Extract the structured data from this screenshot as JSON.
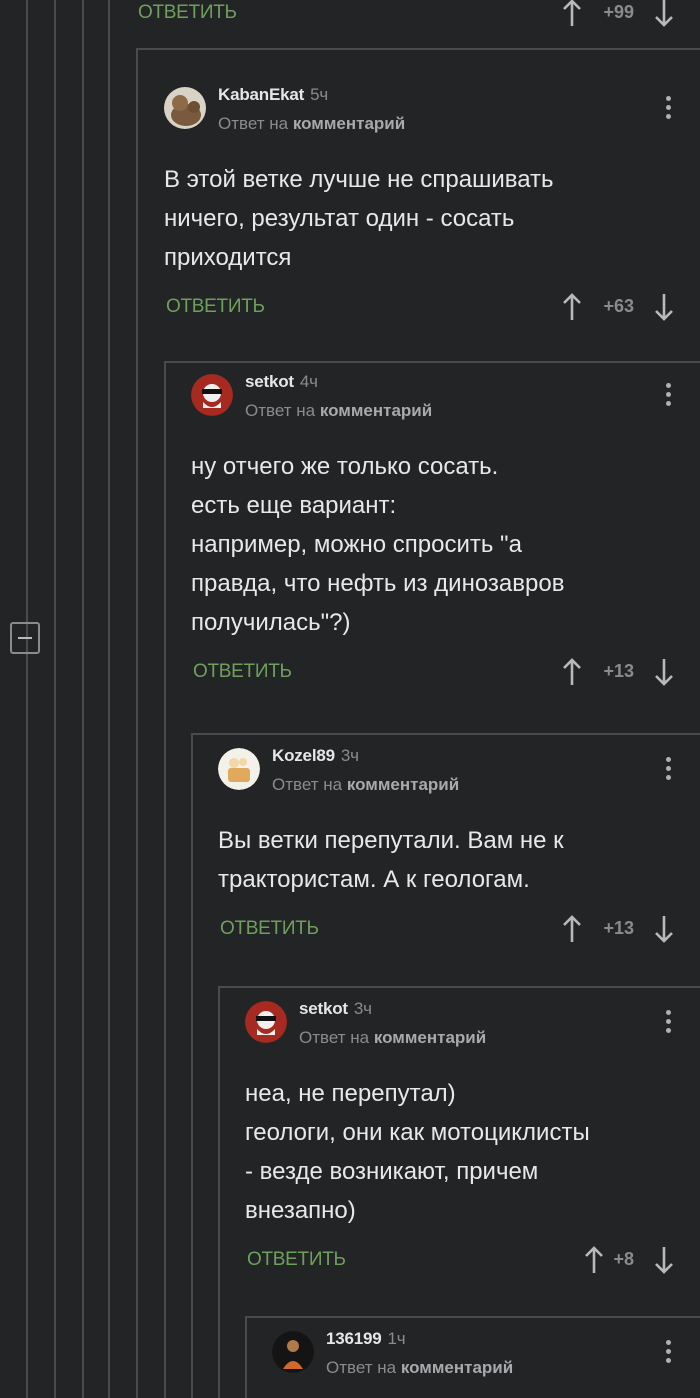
{
  "top_actions": {
    "answer": "ОТВЕТИТЬ",
    "rating": "+99"
  },
  "comments": [
    {
      "username": "KabanEkat",
      "time": "5ч",
      "reply_prefix": "Ответ на",
      "reply_link": "комментарий",
      "lines": [
        "В этой ветке лучше не спрашивать",
        "ничего, результат один - сосать",
        "приходится"
      ],
      "answer": "ОТВЕТИТЬ",
      "rating": "+63"
    },
    {
      "username": "setkot",
      "time": "4ч",
      "reply_prefix": "Ответ на",
      "reply_link": "комментарий",
      "lines": [
        "ну отчего же только сосать.",
        "есть еще вариант:",
        "например, можно спросить \"а",
        "правда, что нефть из динозавров",
        "получилась\"?)"
      ],
      "answer": "ОТВЕТИТЬ",
      "rating": "+13"
    },
    {
      "username": "Kozel89",
      "time": "3ч",
      "reply_prefix": "Ответ на",
      "reply_link": "комментарий",
      "lines": [
        "Вы ветки перепутали. Вам не к",
        "трактористам. А к геологам."
      ],
      "answer": "ОТВЕТИТЬ",
      "rating": "+13"
    },
    {
      "username": "setkot",
      "time": "3ч",
      "reply_prefix": "Ответ на",
      "reply_link": "комментарий",
      "lines": [
        "неа, не перепутал)",
        "геологи, они как мотоциклисты",
        "- везде возникают, причем",
        "внезапно)"
      ],
      "answer": "ОТВЕТИТЬ",
      "rating": "+8"
    },
    {
      "username": "136199",
      "time": "1ч",
      "reply_prefix": "Ответ на",
      "reply_link": "комментарий",
      "lines": [],
      "answer": "",
      "rating": ""
    }
  ]
}
